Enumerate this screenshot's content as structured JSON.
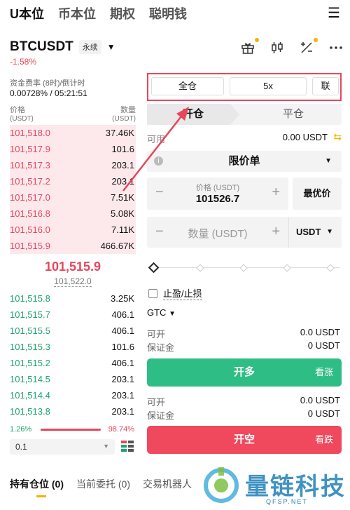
{
  "nav": {
    "tabs": [
      "U本位",
      "币本位",
      "期权",
      "聪明钱"
    ],
    "menu_icon": "hamburger-menu-icon"
  },
  "pair": {
    "symbol": "BTCUSDT",
    "type": "永续",
    "change": "-1.58%"
  },
  "header_icons": [
    "gift-icon",
    "candlestick-icon",
    "calculator-icon",
    "more-icon"
  ],
  "funding": {
    "label": "资金费率 (8时)/倒计时",
    "value": "0.00728% / 05:21:51"
  },
  "orderbook": {
    "price_label": "价格",
    "price_unit": "(USDT)",
    "qty_label": "数量",
    "qty_unit": "(USDT)",
    "asks": [
      {
        "price": "101,518.0",
        "qty": "37.46K"
      },
      {
        "price": "101,517.9",
        "qty": "101.6"
      },
      {
        "price": "101,517.3",
        "qty": "203.1"
      },
      {
        "price": "101,517.2",
        "qty": "203.1"
      },
      {
        "price": "101,517.0",
        "qty": "7.51K"
      },
      {
        "price": "101,516.8",
        "qty": "5.08K"
      },
      {
        "price": "101,516.0",
        "qty": "7.11K"
      },
      {
        "price": "101,515.9",
        "qty": "466.67K"
      }
    ],
    "mid_price": "101,515.9",
    "mark_price": "101,522.0",
    "bids": [
      {
        "price": "101,515.8",
        "qty": "3.25K"
      },
      {
        "price": "101,515.7",
        "qty": "406.1"
      },
      {
        "price": "101,515.5",
        "qty": "406.1"
      },
      {
        "price": "101,515.3",
        "qty": "101.6"
      },
      {
        "price": "101,515.2",
        "qty": "406.1"
      },
      {
        "price": "101,514.5",
        "qty": "203.1"
      },
      {
        "price": "101,514.4",
        "qty": "203.1"
      },
      {
        "price": "101,513.8",
        "qty": "203.1"
      }
    ],
    "buy_ratio": "1.26%",
    "sell_ratio": "98.74%",
    "buy_fraction": 0.0126,
    "depth": "0.1"
  },
  "trade": {
    "margin_mode": "全仓",
    "leverage": "5x",
    "more_mode": "联",
    "open_tab": "开仓",
    "close_tab": "平仓",
    "available_label": "可用",
    "available_value": "0.00 USDT",
    "order_type": "限价单",
    "price_label": "价格 (USDT)",
    "price_value": "101526.7",
    "best_price": "最优价",
    "qty_placeholder": "数量 (USDT)",
    "unit": "USDT",
    "tpsl": "止盈/止损",
    "tif": "GTC",
    "long": {
      "open_label": "可开",
      "open_value": "0.0 USDT",
      "margin_label": "保证金",
      "margin_value": "0 USDT",
      "button": "开多",
      "side": "看涨"
    },
    "short": {
      "open_label": "可开",
      "open_value": "0.0 USDT",
      "margin_label": "保证金",
      "margin_value": "0 USDT",
      "button": "开空",
      "side": "看跌"
    }
  },
  "bottom_tabs": [
    "持有仓位 (0)",
    "当前委托 (0)",
    "交易机器人"
  ],
  "watermark": {
    "text": "量链科技",
    "sub": "QFSP.NET"
  },
  "colors": {
    "red": "#e8465c",
    "green": "#1da36f",
    "buy_button": "#2ebd85",
    "sell_button": "#f0485d",
    "accent": "#f5b400"
  }
}
